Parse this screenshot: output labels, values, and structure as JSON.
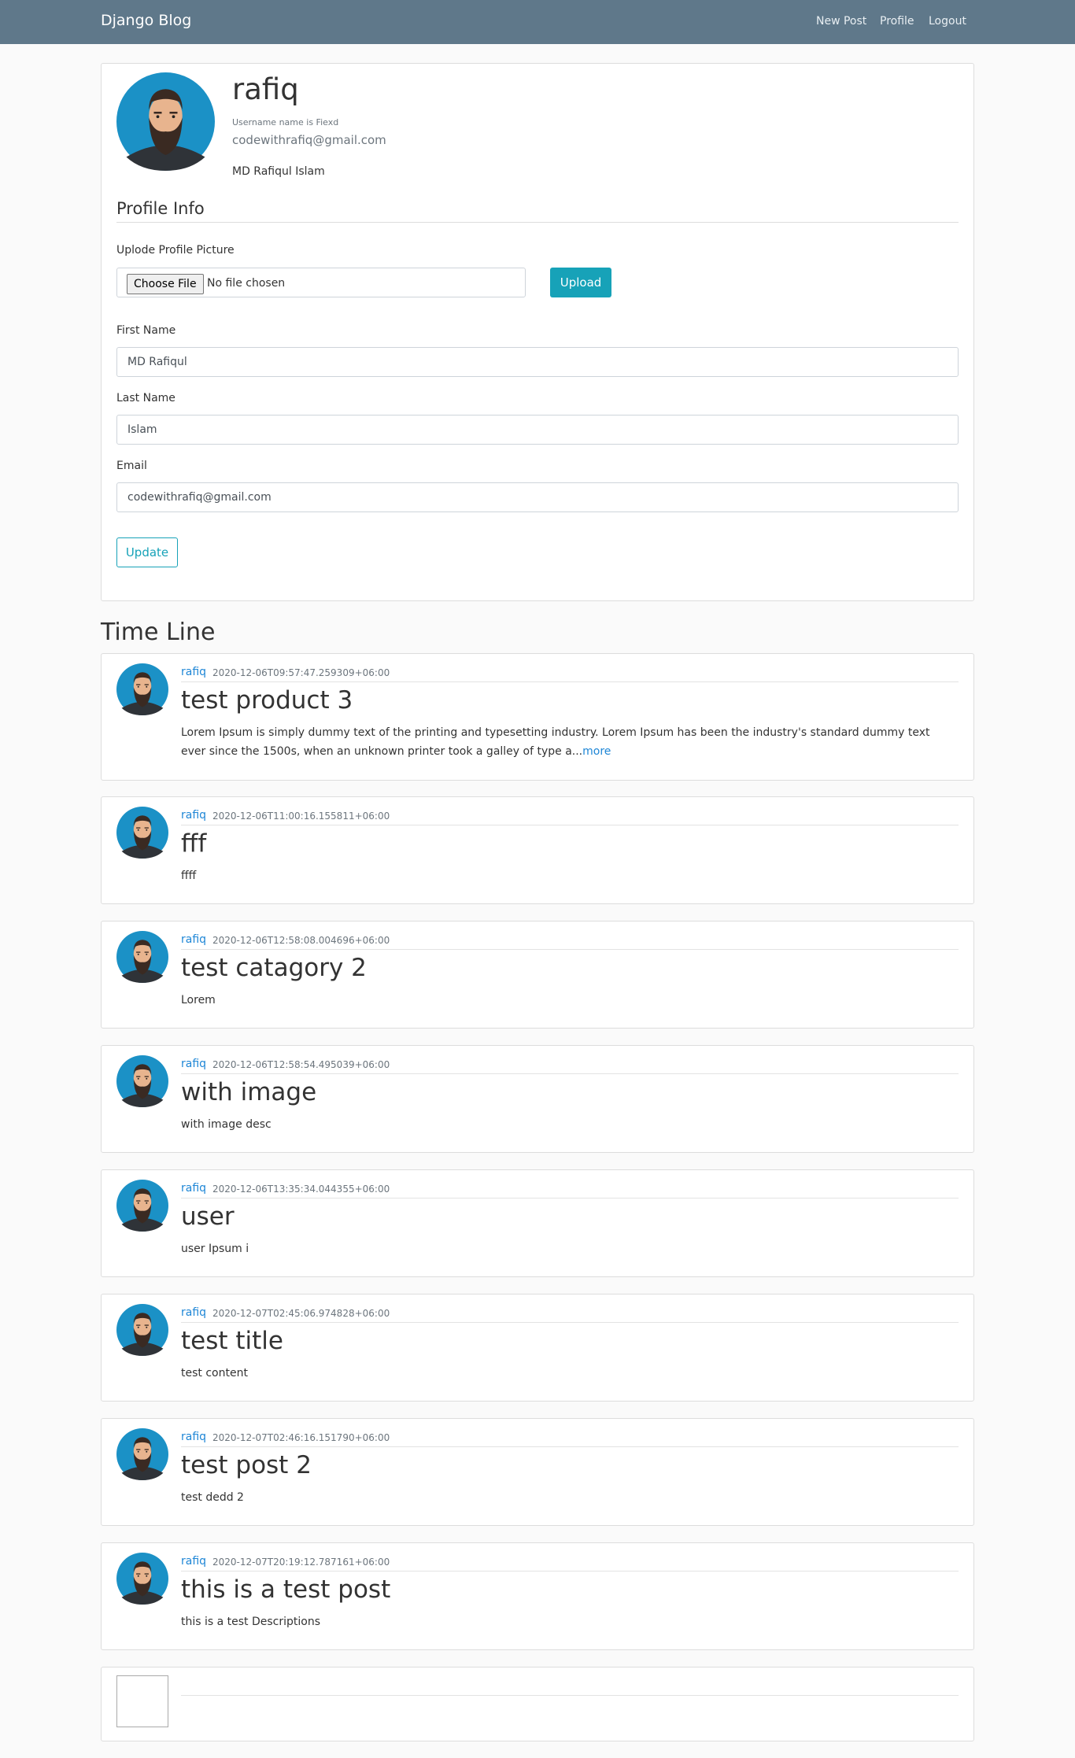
{
  "navbar": {
    "brand": "Django Blog",
    "links": [
      "New Post",
      "Profile",
      "Logout"
    ]
  },
  "profile": {
    "username": "rafiq",
    "username_note": "Username name is Fiexd",
    "email": "codewithrafiq@gmail.com",
    "full_name": "MD Rafiqul Islam",
    "section_title": "Profile Info",
    "upload_label": "Uplode Profile Picture",
    "choose_file_label": "Choose File",
    "no_file_text": "No file chosen",
    "upload_button": "Upload",
    "first_name_label": "First Name",
    "first_name_value": "MD Rafiqul",
    "last_name_label": "Last Name",
    "last_name_value": "Islam",
    "email_label": "Email",
    "email_value": "codewithrafiq@gmail.com",
    "update_button": "Update"
  },
  "timeline": {
    "title": "Time Line",
    "posts": [
      {
        "author": "rafiq",
        "date": "2020-12-06T09:57:47.259309+06:00",
        "title": "test product 3",
        "body": "Lorem Ipsum is simply dummy text of the printing and typesetting industry. Lorem Ipsum has been the industry's standard dummy text ever since the 1500s, when an unknown printer took a galley of type a...",
        "more": "more"
      },
      {
        "author": "rafiq",
        "date": "2020-12-06T11:00:16.155811+06:00",
        "title": "fff",
        "body": "ffff"
      },
      {
        "author": "rafiq",
        "date": "2020-12-06T12:58:08.004696+06:00",
        "title": "test catagory 2",
        "body": "Lorem"
      },
      {
        "author": "rafiq",
        "date": "2020-12-06T12:58:54.495039+06:00",
        "title": "with image",
        "body": "with image desc"
      },
      {
        "author": "rafiq",
        "date": "2020-12-06T13:35:34.044355+06:00",
        "title": "user",
        "body": "user Ipsum i"
      },
      {
        "author": "rafiq",
        "date": "2020-12-07T02:45:06.974828+06:00",
        "title": "test title",
        "body": "test content"
      },
      {
        "author": "rafiq",
        "date": "2020-12-07T02:46:16.151790+06:00",
        "title": "test post 2",
        "body": "test dedd 2"
      },
      {
        "author": "rafiq",
        "date": "2020-12-07T20:19:12.787161+06:00",
        "title": "this is a test post",
        "body": "this is a test Descriptions"
      }
    ]
  },
  "colors": {
    "navbar": "#5f788a",
    "accent": "#17a2b8",
    "link": "#1e86d6"
  }
}
